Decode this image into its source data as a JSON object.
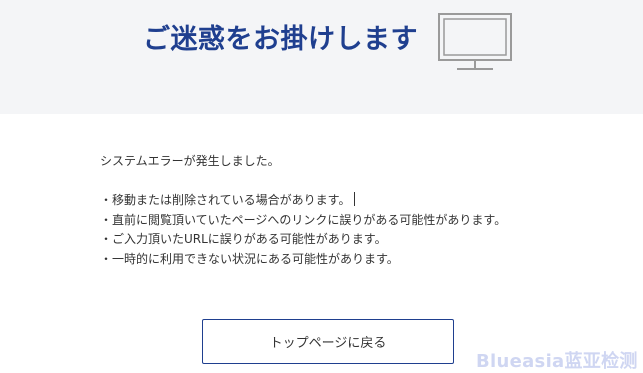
{
  "header": {
    "title": "ご迷惑をお掛けします",
    "icon": "monitor-icon"
  },
  "content": {
    "intro": "システムエラーが発生しました。",
    "reasons": [
      "・移動または削除されている場合があります。",
      "・直前に閲覧頂いていたページへのリンクに誤りがある可能性があります。",
      "・ご入力頂いたURLに誤りがある可能性があります。",
      "・一時的に利用できない状況にある可能性があります。"
    ]
  },
  "button": {
    "label": "トップページに戻る"
  },
  "watermark": {
    "text": "Blueasia蓝亚检测"
  },
  "colors": {
    "header_bg": "#f4f5f7",
    "title": "#1f3f8f",
    "button_border": "#1f3f8f",
    "body_text": "#333333",
    "icon_stroke": "#9a9a9a"
  }
}
